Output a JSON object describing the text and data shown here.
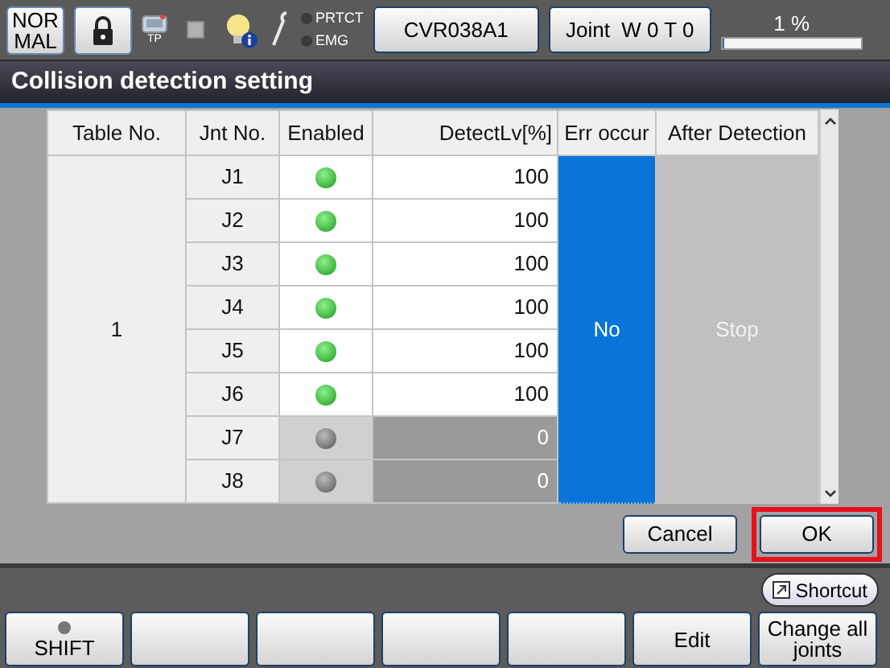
{
  "header": {
    "mode_lines": [
      "NOR",
      "MAL"
    ],
    "tp_label": "TP",
    "indicators": [
      {
        "label": "PRTCT",
        "lit": false
      },
      {
        "label": "EMG",
        "lit": false
      }
    ],
    "robot": "CVR038A1",
    "joint": "Joint  W 0 T 0",
    "speed": {
      "reading": "1 %",
      "level": 0.01
    }
  },
  "window": {
    "title": "Collision detection setting"
  },
  "table": {
    "columns": [
      "Table No.",
      "Jnt No.",
      "Enabled",
      "DetectLv[%]",
      "Err occur",
      "After Detection"
    ],
    "table_no": "1",
    "err_occur": "No",
    "after_detection": "Stop",
    "rows": [
      {
        "joint": "J1",
        "enabled": true,
        "detect_level": "100"
      },
      {
        "joint": "J2",
        "enabled": true,
        "detect_level": "100"
      },
      {
        "joint": "J3",
        "enabled": true,
        "detect_level": "100"
      },
      {
        "joint": "J4",
        "enabled": true,
        "detect_level": "100"
      },
      {
        "joint": "J5",
        "enabled": true,
        "detect_level": "100"
      },
      {
        "joint": "J6",
        "enabled": true,
        "detect_level": "100"
      },
      {
        "joint": "J7",
        "enabled": false,
        "detect_level": "0"
      },
      {
        "joint": "J8",
        "enabled": false,
        "detect_level": "0"
      }
    ]
  },
  "dialog_buttons": [
    {
      "label": "Cancel",
      "highlighted": false
    },
    {
      "label": "OK",
      "highlighted": true
    }
  ],
  "shortcut": "Shortcut",
  "function_keys": [
    {
      "kind": "shift",
      "label": "SHIFT",
      "lit": false
    },
    {
      "kind": "blank"
    },
    {
      "kind": "blank"
    },
    {
      "kind": "blank"
    },
    {
      "kind": "blank"
    },
    {
      "kind": "key",
      "label": "Edit"
    },
    {
      "kind": "key",
      "label": "Change all joints"
    }
  ]
}
